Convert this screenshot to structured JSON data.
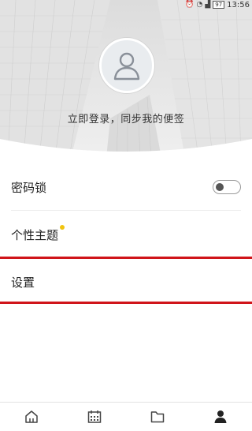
{
  "status_bar": {
    "battery": "97",
    "time": "13:56",
    "icons": [
      "alarm-icon",
      "clock-icon",
      "signal-icon",
      "battery-icon"
    ]
  },
  "header": {
    "avatar_icon": "user-icon",
    "login_prompt": "立即登录，同步我的便签"
  },
  "menu": {
    "password_lock": {
      "label": "密码锁",
      "toggle_on": false
    },
    "theme": {
      "label": "个性主题",
      "has_new_dot": true
    },
    "settings": {
      "label": "设置",
      "highlighted": true
    }
  },
  "bottom_nav": {
    "items": [
      {
        "icon": "home-icon",
        "active": false
      },
      {
        "icon": "calendar-icon",
        "active": false
      },
      {
        "icon": "folder-icon",
        "active": false
      },
      {
        "icon": "person-icon",
        "active": true
      }
    ]
  },
  "colors": {
    "highlight_red": "#d0141a",
    "new_dot": "#f1c40f",
    "header_bg": "#e6e6e6"
  }
}
